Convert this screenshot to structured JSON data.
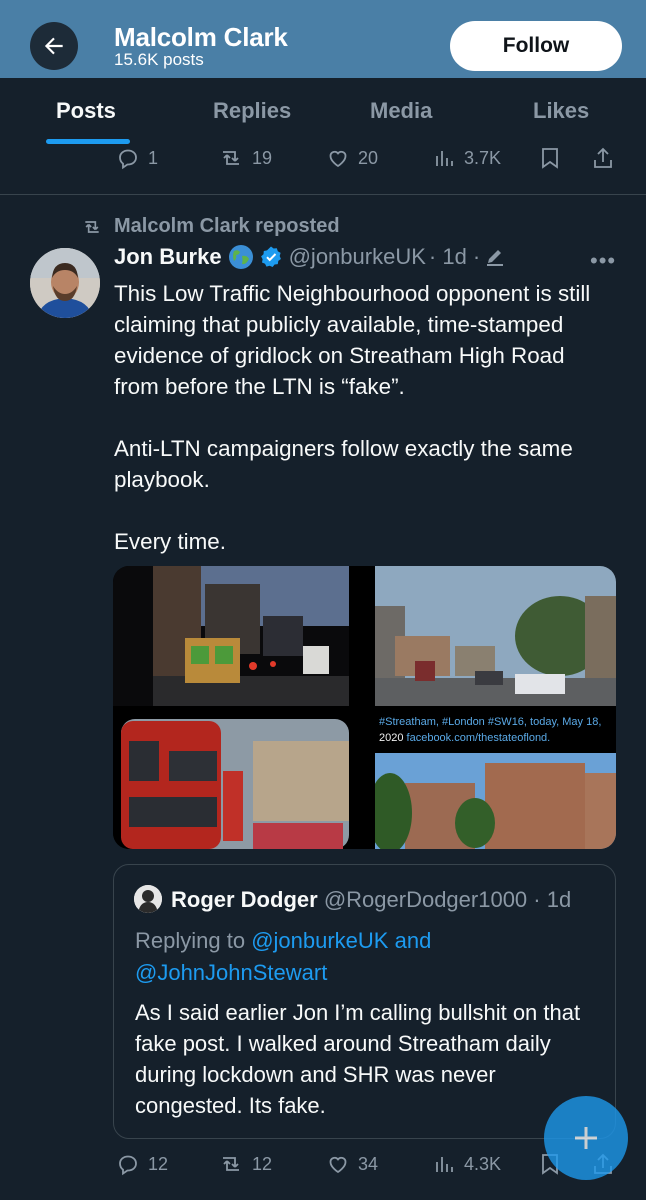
{
  "header": {
    "name": "Malcolm Clark",
    "posts_count": "15.6K posts",
    "follow_label": "Follow"
  },
  "tabs": [
    "Posts",
    "Replies",
    "Media",
    "Likes"
  ],
  "prev_tweet_actions": {
    "replies": "1",
    "reposts": "19",
    "likes": "20",
    "views": "3.7K"
  },
  "repost_label": "Malcolm Clark reposted",
  "tweet": {
    "author": "Jon Burke",
    "handle": "@jonburkeUK",
    "time": "· 1d ·",
    "paragraphs": [
      "This Low Traffic Neighbourhood opponent is still claiming that publicly available, time-stamped evidence of gridlock on Streatham High Road from before the LTN is “fake”.",
      "Anti-LTN campaigners follow exactly the same playbook.",
      "Every time."
    ],
    "media_caption_line1": "#Streatham, #London #SW16, today, May 18,",
    "media_caption_line2_prefix": "2020 ",
    "media_caption_link": "facebook.com/thestateoflond.",
    "actions": {
      "replies": "12",
      "reposts": "12",
      "likes": "34",
      "views": "4.3K"
    }
  },
  "quote": {
    "author": "Roger Dodger",
    "handle": "@RogerDodger1000",
    "time": "· 1d",
    "replying_prefix": "Replying to ",
    "replying_to_1": "@jonburkeUK",
    "replying_and": " and ",
    "replying_to_2": "@JohnJohnStewart",
    "text": "As I said earlier Jon I’m calling bullshit on that fake post. I walked around Streatham daily during lockdown and SHR was never congested. Its fake."
  },
  "colors": {
    "background": "#15202b",
    "accent": "#1d9bf0",
    "muted": "#8b98a5",
    "banner": "#4a7fa6"
  }
}
